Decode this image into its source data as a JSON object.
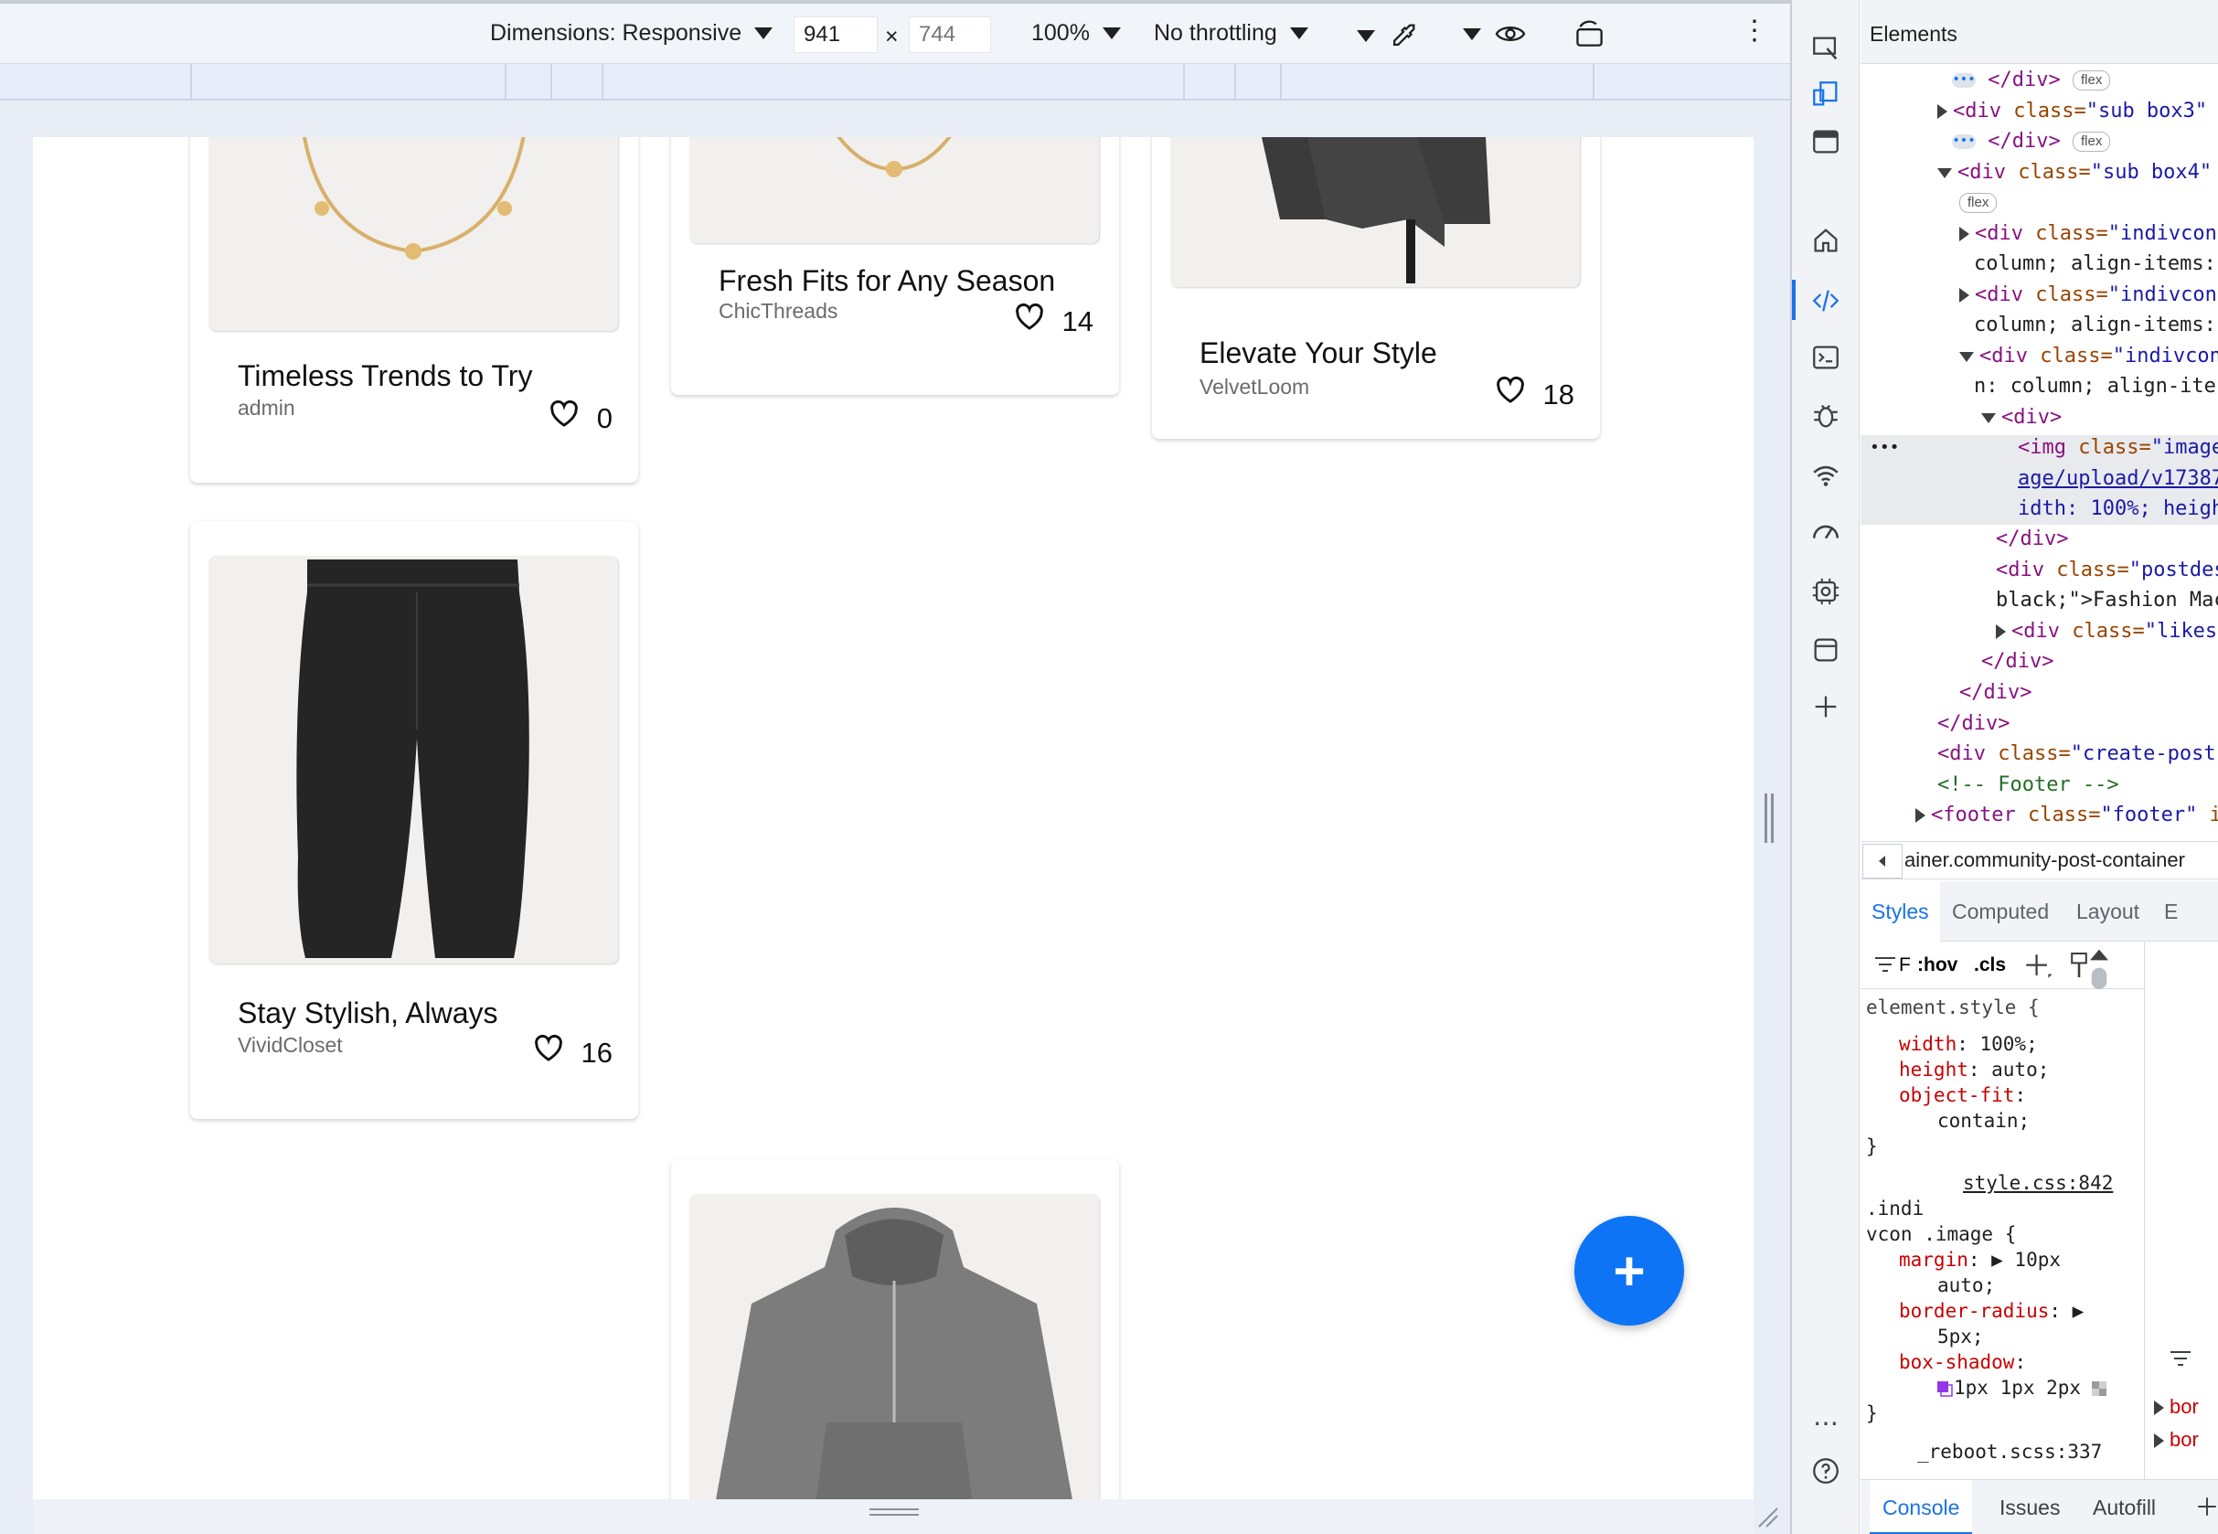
{
  "toolbar": {
    "dimensions_label": "Dimensions: Responsive",
    "width": "941",
    "height_placeholder": "744",
    "times": "×",
    "zoom": "100%",
    "throttling": "No throttling"
  },
  "cards": [
    {
      "title": "Timeless Trends to Try",
      "author": "admin",
      "likes": "0"
    },
    {
      "title": "Fresh Fits for Any Season",
      "author": "ChicThreads",
      "likes": "14"
    },
    {
      "title": "Elevate Your Style",
      "author": "VelvetLoom",
      "likes": "18"
    },
    {
      "title": "Stay Stylish, Always",
      "author": "VividCloset",
      "likes": "16"
    }
  ],
  "fab_label": "+",
  "devtools": {
    "panel_title": "Elements",
    "breadcrumb": "ainer.community-post-container",
    "styles_tabs": [
      "Styles",
      "Computed",
      "Layout",
      "E"
    ],
    "filter_placeholder": "F",
    "hov": ":hov",
    "cls": ".cls",
    "drawer_tabs": [
      "Console",
      "Issues",
      "Autofill"
    ],
    "dom": {
      "l1_close": "</div>",
      "flex": "flex",
      "l2_tag": "<div",
      "l2_attr": " class=",
      "l2_val": "\"sub box3\"",
      "l3_close": "</div>",
      "l4_tag": "<div",
      "l4_attr": " class=",
      "l4_val": "\"sub box4\"",
      "l6_tag": "<div",
      "l6_attr": " class=",
      "l6_val": "\"indivcon",
      "l7": "column; align-items:",
      "l8_tag": "<div",
      "l8_attr": " class=",
      "l8_val": "\"indivcon",
      "l9": "column; align-items:",
      "l10_tag": "<div",
      "l10_attr": " class=",
      "l10_val": "\"indivcon",
      "l11": "n: column; align-ite",
      "l12": "<div>",
      "l13_tag": "<img",
      "l13_attr": " class=",
      "l13_val": "\"image",
      "l14": "age/upload/v17387",
      "l15": "idth: 100%; heigh",
      "l16": "</div>",
      "l17_tag": "<div",
      "l17_attr": " class=",
      "l17_val": "\"postdes",
      "l18": "black;\">Fashion Mac",
      "l19_tag": "<div",
      "l19_attr": " class=",
      "l19_val": "\"likes\"",
      "l20": "</div>",
      "l21": "</div>",
      "l22": "</div>",
      "l23_tag": "<div",
      "l23_attr": " class=",
      "l23_val": "\"create-post-",
      "l24": "<!-- Footer -->",
      "l25_tag": "<footer",
      "l25_attr": " class=",
      "l25_val": "\"footer\"",
      "l25_tail": " i"
    },
    "styles": {
      "s1": "element.style {",
      "s2p": "width",
      "s2v": ": 100%;",
      "s3p": "height",
      "s3v": ": auto;",
      "s4p": "object-fit",
      "s4v": ":",
      "s5": "contain;",
      "s6": "}",
      "s7": "style.css:842",
      "s8": ".indi",
      "s9": "vcon .image {",
      "s10p": "margin",
      "s10v": ": ▶ 10px",
      "s11": "auto;",
      "s12p": "border-radius",
      "s12v": ": ▶",
      "s13": "5px;",
      "s14p": "box-shadow",
      "s14v": ":",
      "s15": "1px 1px 2px",
      "s16": "}",
      "s17": "_reboot.scss:337"
    },
    "right_col": [
      "bor",
      "bor"
    ]
  }
}
